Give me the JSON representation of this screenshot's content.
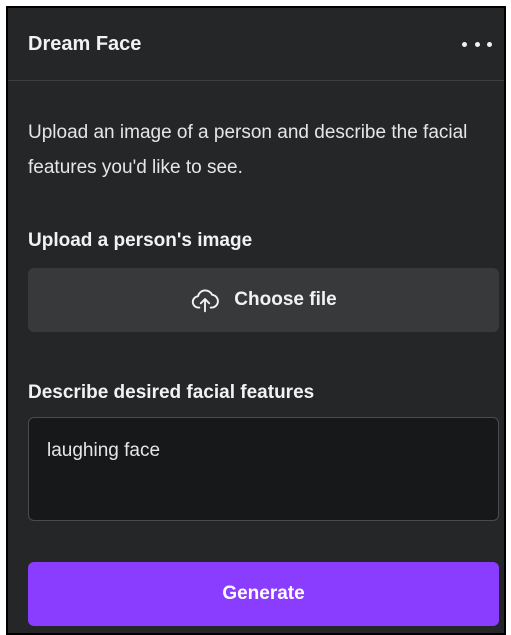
{
  "app": {
    "title": "Dream Face",
    "menu_icon": "more-horizontal-icon"
  },
  "intro": {
    "text": "Upload an image of a person and describe the facial features you'd like to see."
  },
  "upload": {
    "label": "Upload a person's image",
    "button_label": "Choose file",
    "button_icon": "cloud-upload-icon"
  },
  "features": {
    "label": "Describe desired facial features",
    "value": "laughing face"
  },
  "actions": {
    "generate_label": "Generate"
  },
  "colors": {
    "panel_background": "#252627",
    "button_background": "#38393b",
    "input_background": "#17181a",
    "accent": "#8b3dff",
    "text": "#f2f2f2"
  }
}
